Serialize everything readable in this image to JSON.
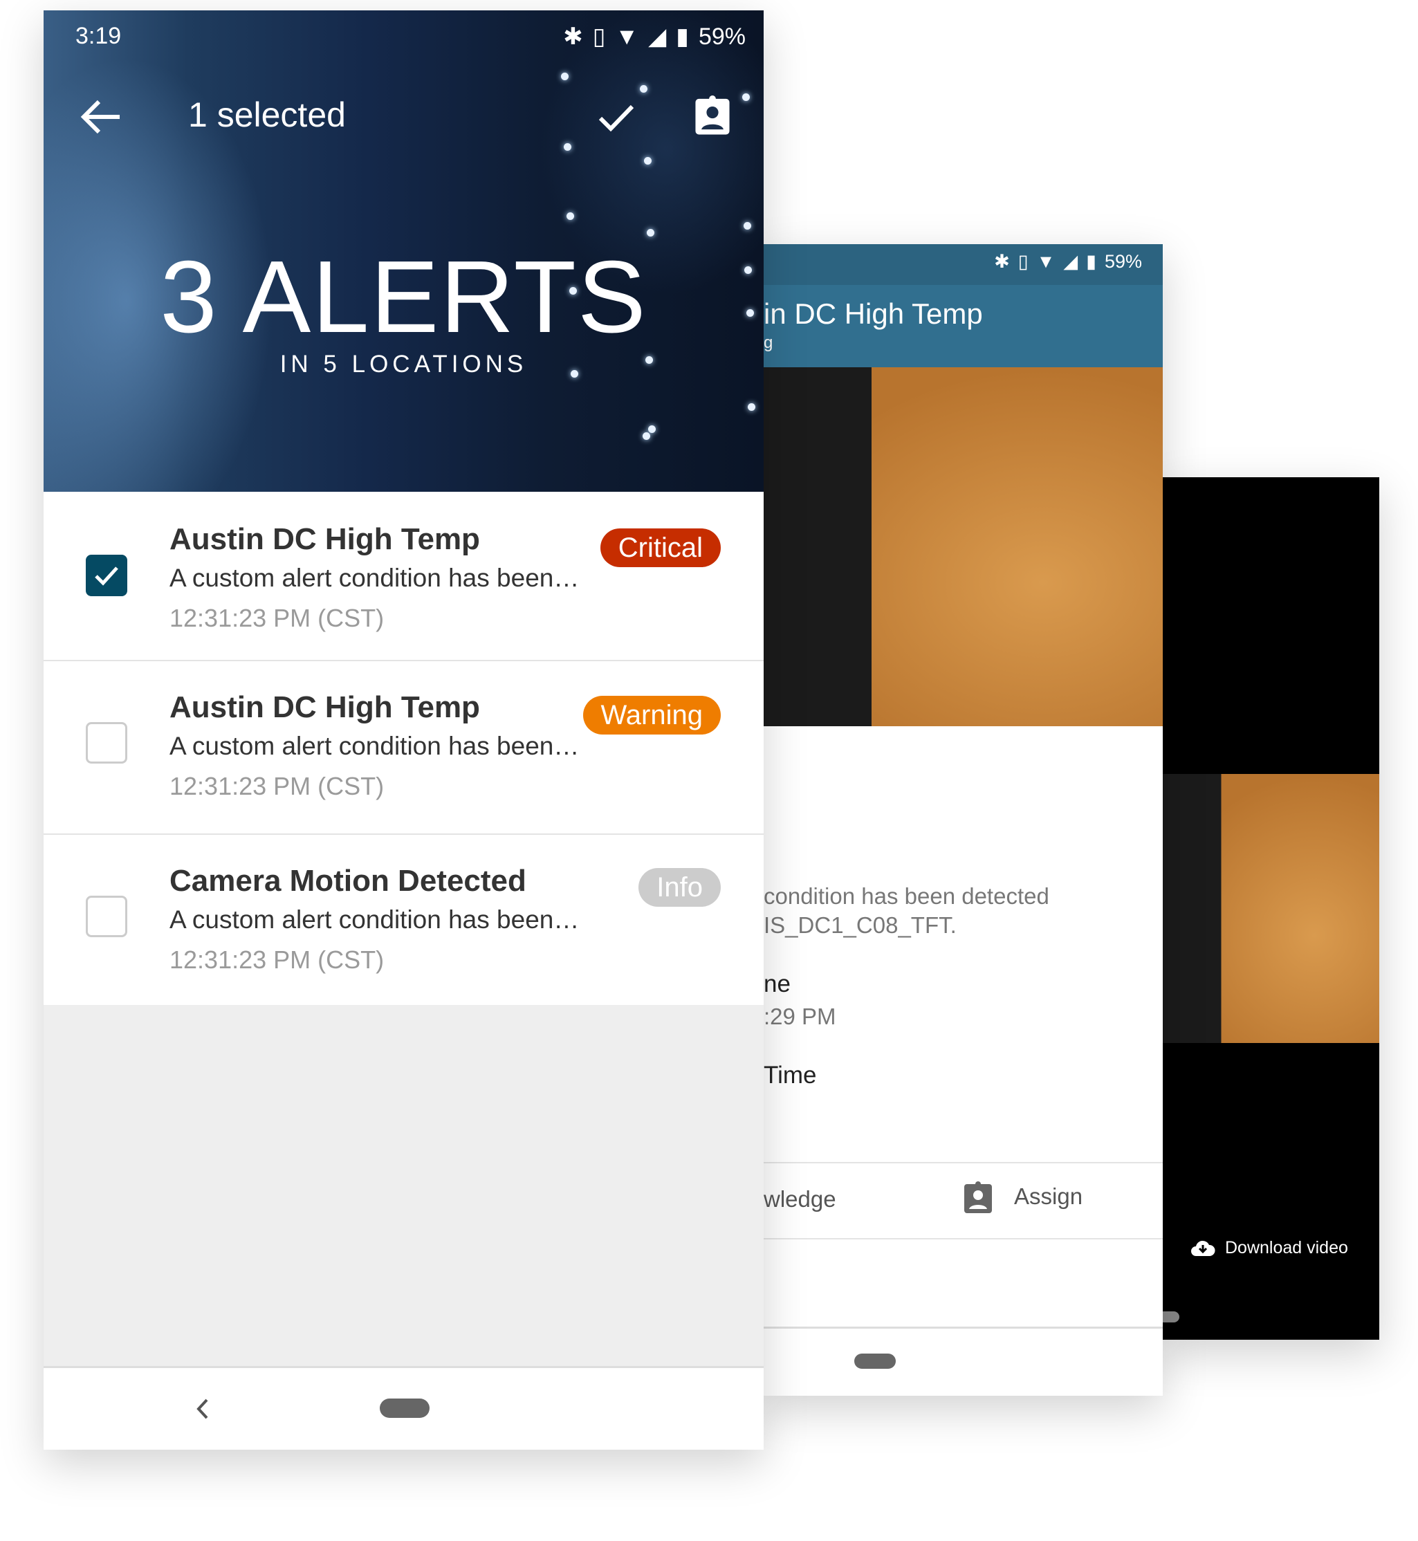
{
  "screen1": {
    "status": {
      "time": "3:19",
      "battery": "59%",
      "icons": [
        "bluetooth-icon",
        "vibrate-icon",
        "wifi-icon",
        "signal-icon",
        "battery-icon"
      ]
    },
    "toolbar": {
      "title": "1 selected",
      "back_icon": "arrow-left-icon",
      "confirm_icon": "check-icon",
      "assign_icon": "clipboard-account-icon"
    },
    "hero": {
      "count_label": "3 ALERTS",
      "locations_label": "IN 5 LOCATIONS"
    },
    "alerts": [
      {
        "title": "Austin DC High Temp",
        "description": "A custom alert condition has been…",
        "time": "12:31:23 PM (CST)",
        "severity": "Critical",
        "severity_color": "#c62d00",
        "checked": true
      },
      {
        "title": "Austin DC High Temp",
        "description": "A custom alert condition has been…",
        "time": "12:31:23 PM (CST)",
        "severity": "Warning",
        "severity_color": "#ef7d00",
        "checked": false
      },
      {
        "title": "Camera Motion Detected",
        "description": "A custom alert condition has been…",
        "time": "12:31:23 PM (CST)",
        "severity": "Info",
        "severity_color": "#cccccc",
        "checked": false
      }
    ],
    "nav": {
      "back_icon": "chevron-left-icon"
    }
  },
  "screen2": {
    "status": {
      "battery": "59%"
    },
    "appbar": {
      "title": "in DC High Temp",
      "subtitle": "g",
      "color": "#316f8f"
    },
    "details": {
      "line1": "condition has been detected",
      "line2": "IS_DC1_C08_TFT.",
      "label1": "ne",
      "value1": ":29 PM",
      "label2": "Time"
    },
    "actions": {
      "acknowledge": "wledge",
      "assign": "Assign"
    }
  },
  "screen3": {
    "download_label": "Download video",
    "download_icon": "cloud-download-icon"
  }
}
